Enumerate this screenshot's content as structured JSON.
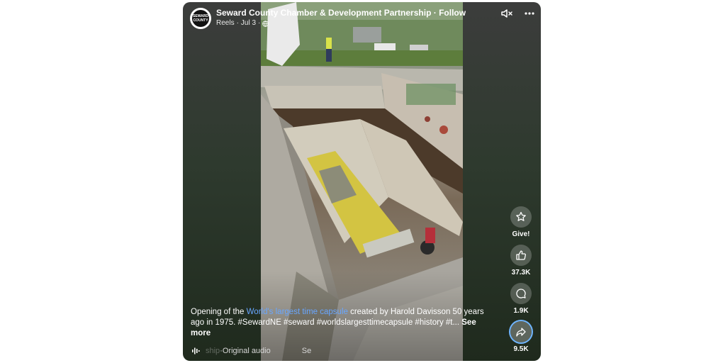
{
  "header": {
    "avatar_text": "SEWARD COUNTY",
    "page_name": "Seward County Chamber & Development Partnership",
    "separator": " · ",
    "follow_label": "Follow",
    "source": "Reels",
    "date": "Jul 3",
    "dot": "·"
  },
  "icons": {
    "mute": "speaker-muted-icon",
    "more": "more-dots-icon",
    "give": "star-give-icon",
    "like": "thumbs-up-icon",
    "comment": "comment-bubble-icon",
    "share": "share-arrow-icon",
    "audio": "audio-wave-icon",
    "privacy": "globe-icon"
  },
  "actions": {
    "give_label": "Give!",
    "like_count": "37.3K",
    "comment_count": "1.9K",
    "share_count": "9.5K"
  },
  "caption": {
    "prefix": "Opening of the ",
    "link": "World's largest time capsule",
    "rest": " created by Harold Davisson 50 years ago in 1975. #SewardNE #seward #worldslargesttimecapsule  #history  #t...",
    "see_more": "See more"
  },
  "audio": {
    "faded_text": "ship",
    "separator": " · ",
    "label": "Original audio",
    "trailing": "Se"
  },
  "colors": {
    "link": "#68a6ff",
    "share_ring": "#6fb5ff"
  }
}
